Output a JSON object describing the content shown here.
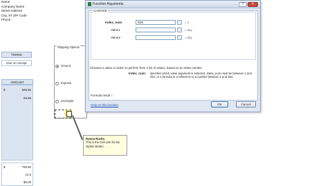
{
  "address": {
    "lines": [
      "Name",
      "Company Name",
      "Street Address",
      "City, ST  ZIP Code",
      "Phone"
    ]
  },
  "sheet": {
    "terms_header": "TERMS",
    "terms_value": "Due on receipt",
    "amount_header": "AMOUNT",
    "rows": [
      {
        "cur": "$",
        "num": "699.95"
      },
      {
        "cur": "",
        "num": "99.99"
      },
      {
        "cur": "$",
        "num": "799.90"
      },
      {
        "cur": "",
        "num": "12.5"
      },
      {
        "cur": "",
        "num": "$5.00"
      }
    ]
  },
  "shipping": {
    "group_label": "Shipping Options",
    "options": [
      {
        "label": "Ground",
        "selected": true
      },
      {
        "label": "Express",
        "selected": false
      },
      {
        "label": "Overnight",
        "selected": false
      }
    ]
  },
  "callout": {
    "title": "Donna Rocks:",
    "body": "This is the Cell Link for the Option Button."
  },
  "dialog": {
    "title": "Function Arguments",
    "help_glyph": "?",
    "close_glyph": "✕",
    "function_name": "CHOOSE",
    "args": [
      {
        "label": "Index_num",
        "value": "N25",
        "result": "= 1"
      },
      {
        "label": "Value1",
        "value": "",
        "result": "= any"
      },
      {
        "label": "Value2",
        "value": "",
        "result": "= any"
      }
    ],
    "description": "Chooses a value or action to perform from a list of values, based on an index number.",
    "arg_desc_label": "Index_num:",
    "arg_desc": "specifies which value argument is selected. Index_num must be between 1 and 254, or a formula or a reference to a number between 1 and 254.",
    "formula_result": "Formula result =",
    "help_link": "Help on this function",
    "ok_label": "OK",
    "cancel_label": "Cancel"
  },
  "colors": {
    "header_fill": "#dbe5f1",
    "callout_fill": "#fffde0",
    "cursor_highlight": "#f3ec64",
    "dialog_bg": "#dfe7f2"
  }
}
